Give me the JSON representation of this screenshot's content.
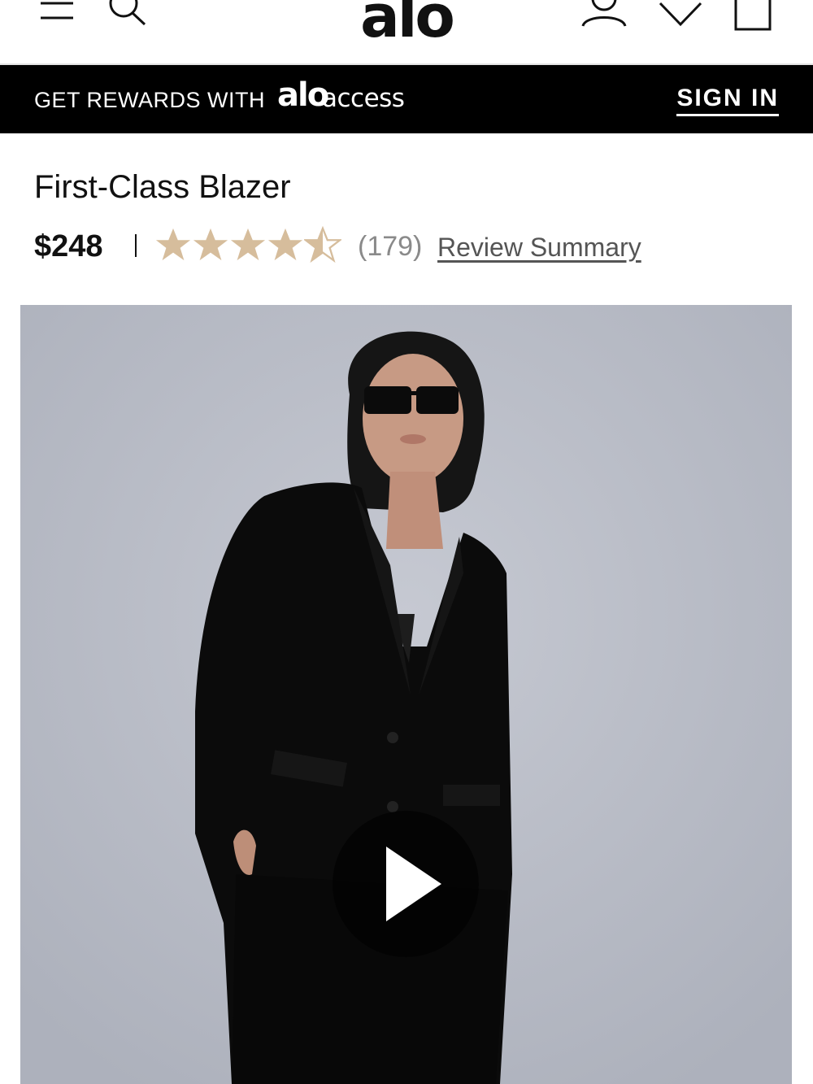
{
  "header": {
    "logo_text": "alo",
    "icons": [
      "menu-icon",
      "search-icon",
      "account-icon",
      "wishlist-icon",
      "bag-icon"
    ]
  },
  "rewards_banner": {
    "text": "GET REWARDS WITH",
    "brand": "alo",
    "brand_suffix": "access",
    "sign_in": "SIGN IN"
  },
  "product": {
    "title": "First-Class Blazer",
    "price": "$248",
    "rating": 4.5,
    "rating_max": 5,
    "review_count": "(179)",
    "review_link": "Review Summary",
    "media_type": "video",
    "star_color": "#d6bd9c"
  },
  "colors": {
    "banner_bg": "#000000",
    "image_bg": "#b6bac4"
  }
}
